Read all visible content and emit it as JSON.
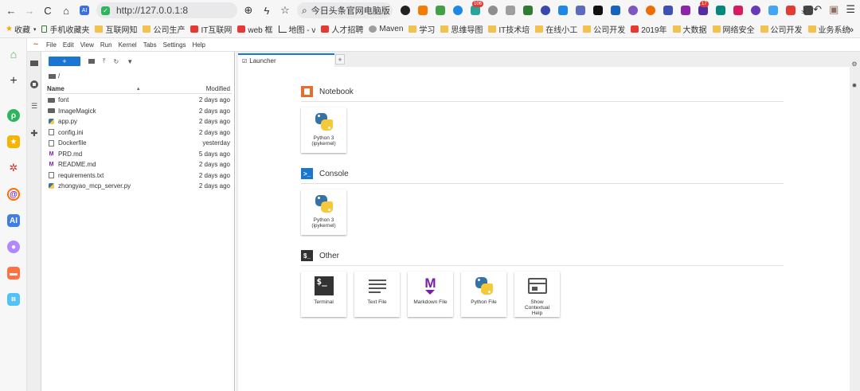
{
  "browser": {
    "nav": {
      "back": "←",
      "forward": "→",
      "reload": "C",
      "home": "⌂"
    },
    "url": "http://127.0.0.1:8",
    "search_placeholder": "今日头条官网电脑版",
    "ext_badge_1": "106",
    "ext_badge_2": "17",
    "right_tools": {
      "download": "⤓",
      "undo": "↶",
      "wallet": "▣",
      "menu": "☰"
    }
  },
  "bookmarks": {
    "star_label": "收藏",
    "items": [
      {
        "label": "手机收藏夹",
        "icon": "phone-icon"
      },
      {
        "label": "互联网知",
        "icon": "folder-icon"
      },
      {
        "label": "公司生产",
        "icon": "folder-icon"
      },
      {
        "label": "IT互联网",
        "icon": "site-icon"
      },
      {
        "label": "web 框",
        "icon": "site-icon"
      },
      {
        "label": "地图 - v",
        "icon": "chart-icon"
      },
      {
        "label": "人才招聘",
        "icon": "site-icon"
      },
      {
        "label": "Maven",
        "icon": "globe-icon"
      },
      {
        "label": "学习",
        "icon": "folder-icon"
      },
      {
        "label": "思维导图",
        "icon": "folder-icon"
      },
      {
        "label": "IT技术培",
        "icon": "folder-icon"
      },
      {
        "label": "在线小工",
        "icon": "folder-icon"
      },
      {
        "label": "公司开发",
        "icon": "folder-icon"
      },
      {
        "label": "2019年",
        "icon": "site-icon"
      },
      {
        "label": "大数据",
        "icon": "folder-icon"
      },
      {
        "label": "网络安全",
        "icon": "folder-icon"
      },
      {
        "label": "公司开发",
        "icon": "folder-icon"
      },
      {
        "label": "业务系统",
        "icon": "folder-icon"
      }
    ],
    "more": "»"
  },
  "jupyter": {
    "menus": [
      "File",
      "Edit",
      "View",
      "Run",
      "Kernel",
      "Tabs",
      "Settings",
      "Help"
    ],
    "new_button": "+",
    "breadcrumb": "/",
    "columns": {
      "name": "Name",
      "modified": "Modified",
      "sort_indicator": "▲"
    },
    "files": [
      {
        "name": "font",
        "modified": "2 days ago",
        "type": "dir"
      },
      {
        "name": "ImageMagick",
        "modified": "2 days ago",
        "type": "dir"
      },
      {
        "name": "app.py",
        "modified": "2 days ago",
        "type": "py"
      },
      {
        "name": "config.ini",
        "modified": "2 days ago",
        "type": "txt"
      },
      {
        "name": "Dockerfile",
        "modified": "yesterday",
        "type": "txt"
      },
      {
        "name": "PRD.md",
        "modified": "5 days ago",
        "type": "md"
      },
      {
        "name": "README.md",
        "modified": "2 days ago",
        "type": "md"
      },
      {
        "name": "requirements.txt",
        "modified": "2 days ago",
        "type": "txt"
      },
      {
        "name": "zhongyao_mcp_server.py",
        "modified": "2 days ago",
        "type": "py"
      }
    ],
    "tab": {
      "label": "Launcher",
      "plus": "+"
    },
    "launcher": {
      "notebook": {
        "title": "Notebook",
        "cards": [
          {
            "label": "Python 3 (ipykernel)"
          }
        ]
      },
      "console": {
        "title": "Console",
        "cards": [
          {
            "label": "Python 3 (ipykernel)"
          }
        ]
      },
      "other": {
        "title": "Other",
        "cards": [
          {
            "label": "Terminal"
          },
          {
            "label": "Text File"
          },
          {
            "label": "Markdown File"
          },
          {
            "label": "Python File"
          },
          {
            "label": "Show Contextual Help"
          }
        ]
      },
      "terminal_glyph": "$_",
      "console_glyph": ">_",
      "markdown_glyph": "M"
    }
  },
  "colors": {
    "accent": "#1976d2",
    "notebook_icon": "#e46e2e",
    "console_icon": "#1976d2",
    "other_icon": "#333333"
  }
}
